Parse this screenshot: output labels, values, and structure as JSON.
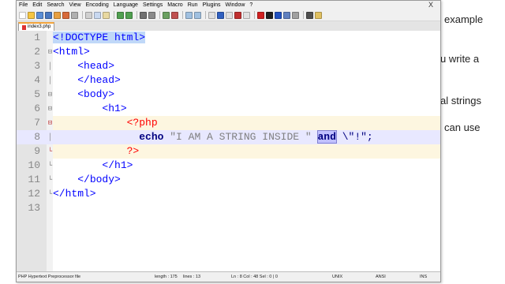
{
  "background_text": {
    "line1": "example",
    "line2": "u write a",
    "line3": "al strings",
    "line4": "can  use"
  },
  "menubar": {
    "items": [
      "File",
      "Edit",
      "Search",
      "View",
      "Encoding",
      "Language",
      "Settings",
      "Macro",
      "Run",
      "Plugins",
      "Window",
      "?"
    ],
    "close": "X"
  },
  "tab": {
    "label": "index3.php"
  },
  "code": {
    "line_numbers": [
      "1",
      "2",
      "3",
      "4",
      "5",
      "6",
      "7",
      "8",
      "9",
      "10",
      "11",
      "12",
      "13"
    ],
    "l1": "<!DOCTYPE html>",
    "l2": "<html>",
    "l3": "<head>",
    "l4": "</head>",
    "l5": "<body>",
    "l6": "<h1>",
    "l7": "<?php",
    "l8_echo": "echo",
    "l8_str": "\"I AM A STRING INSIDE \"",
    "l8_and": "and",
    "l8_rest": "\\\"!\";",
    "l9": "?>",
    "l10": "</h1>",
    "l11": "</body>",
    "l12": "</html>"
  },
  "status": {
    "filetype": "PHP Hypertext Preprocessor file",
    "length": "length : 175",
    "lines": "lines : 13",
    "position": "Ln : 8   Col : 48   Sel : 0 | 0",
    "eol": "UNIX",
    "encoding": "ANSI",
    "mode": "INS"
  },
  "colors": {
    "tag": "#0000ff",
    "php": "#ff0000",
    "keyword": "#000080",
    "string": "#808080",
    "current_line": "#e8e8ff"
  }
}
